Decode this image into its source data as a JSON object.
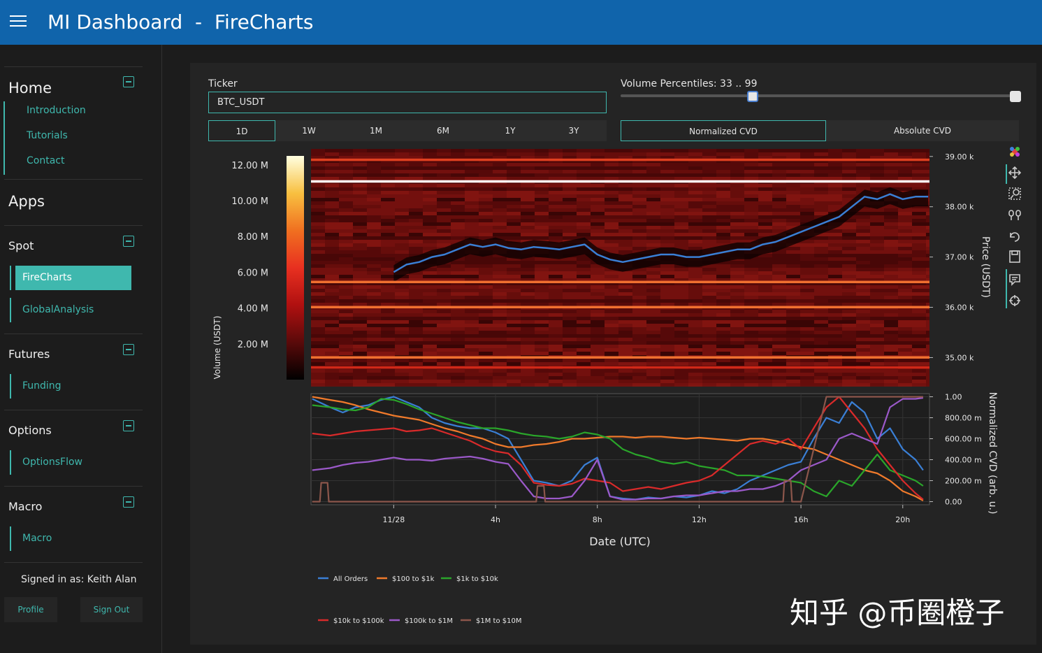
{
  "header": {
    "title": "MI Dashboard  -  FireCharts"
  },
  "sidebar": {
    "home": {
      "title": "Home",
      "items": [
        "Introduction",
        "Tutorials",
        "Contact"
      ]
    },
    "apps_title": "Apps",
    "spot": {
      "title": "Spot",
      "items": [
        "FireCharts",
        "GlobalAnalysis"
      ]
    },
    "futures": {
      "title": "Futures",
      "items": [
        "Funding"
      ]
    },
    "options": {
      "title": "Options",
      "items": [
        "OptionsFlow"
      ]
    },
    "macro": {
      "title": "Macro",
      "items": [
        "Macro"
      ]
    },
    "signed_in": "Signed in as: Keith Alan",
    "profile_label": "Profile",
    "signout_label": "Sign Out"
  },
  "controls": {
    "ticker_label": "Ticker",
    "ticker_value": "BTC_USDT",
    "ranges": [
      "1D",
      "1W",
      "1M",
      "6M",
      "1Y",
      "3Y"
    ],
    "active_range": "1D",
    "volume_percentiles_label": "Volume Percentiles: 33 .. 99",
    "volume_percentiles": [
      33,
      99
    ],
    "cvd_modes": [
      "Normalized CVD",
      "Absolute CVD"
    ],
    "active_cvd_mode": "Normalized CVD"
  },
  "toolbar": {
    "icons": [
      "plotly-logo-icon",
      "pan-icon",
      "zoom-icon",
      "compare-icon",
      "reset-icon",
      "save-icon",
      "hover-icon",
      "spike-icon"
    ]
  },
  "chart_data": [
    {
      "type": "heatmap",
      "colorbar_label": "Volume (USDT)",
      "colorbar_ticks": [
        "12.00 M",
        "10.00 M",
        "8.00 M",
        "6.00 M",
        "4.00 M",
        "2.00 M"
      ],
      "colorbar_tick_values": [
        12,
        10,
        8,
        6,
        4,
        2
      ],
      "colorbar_range": [
        0,
        12.5
      ],
      "colorscale": [
        "#000000",
        "#5a0a0a",
        "#b01010",
        "#e83020",
        "#f07020",
        "#f8c040",
        "#ffffe0"
      ],
      "ylabel": "Price (USDT)",
      "y_ticks": [
        "39.00 k",
        "38.00 k",
        "37.00 k",
        "36.00 k",
        "35.00 k"
      ],
      "y_tick_values": [
        39000,
        38000,
        37000,
        36000,
        35000
      ],
      "ylim": [
        34450,
        39150
      ],
      "bright_levels": [
        {
          "price": 38500,
          "color": "#ffffff"
        },
        {
          "price": 36500,
          "color": "#f07030"
        },
        {
          "price": 36000,
          "color": "#f07030"
        },
        {
          "price": 35000,
          "color": "#f07030"
        },
        {
          "price": 38930,
          "color": "#e04020"
        },
        {
          "price": 34800,
          "color": "#d02818"
        }
      ],
      "price_series": {
        "color": "#3a7fd5",
        "x": [
          0.0,
          0.5,
          1.0,
          1.5,
          2.0,
          2.5,
          3.0,
          3.5,
          4.0,
          4.5,
          5.0,
          5.5,
          6.0,
          6.5,
          7.0,
          7.5,
          8.0,
          8.5,
          9.0,
          9.5,
          10.0,
          10.5,
          11.0,
          11.5,
          12.0,
          12.5,
          13.0,
          13.5,
          14.0,
          14.5,
          15.0,
          15.5,
          16.0,
          16.5,
          17.0,
          17.5,
          18.0,
          18.5,
          19.0,
          19.5,
          20.0,
          20.5,
          21.0
        ],
        "y": [
          36700,
          36850,
          36900,
          37000,
          37050,
          37150,
          37250,
          37200,
          37250,
          37180,
          37150,
          37200,
          37180,
          37150,
          37200,
          37250,
          37050,
          36950,
          36900,
          36950,
          37000,
          37050,
          37050,
          37000,
          37000,
          37050,
          37100,
          37150,
          37150,
          37250,
          37300,
          37400,
          37500,
          37600,
          37700,
          37800,
          38000,
          38200,
          38150,
          38250,
          38150,
          38200,
          38200
        ]
      }
    },
    {
      "type": "line",
      "xlabel": "Date (UTC)",
      "x_ticks": [
        "11/28",
        "4h",
        "8h",
        "12h",
        "16h",
        "20h"
      ],
      "x_tick_values": [
        0.0,
        4.0,
        8.0,
        12.0,
        16.0,
        20.0
      ],
      "xlim": [
        -3.25,
        21.05
      ],
      "ylabel": "Normalized CVD (arb. u.)",
      "y_ticks": [
        "1.00",
        "800.00 m",
        "600.00 m",
        "400.00 m",
        "200.00 m",
        "0.00"
      ],
      "y_tick_values": [
        1.0,
        0.8,
        0.6,
        0.4,
        0.2,
        0.0
      ],
      "ylim": [
        -0.03,
        1.03
      ],
      "legend_position": "bottom",
      "series": [
        {
          "name": "All Orders",
          "color": "#3a7fd5",
          "x": [
            -3.2,
            -2.5,
            -2,
            -1.5,
            -1,
            -0.5,
            0,
            0.5,
            1,
            1.5,
            2,
            2.5,
            3,
            3.5,
            4,
            4.5,
            5,
            5.5,
            6,
            6.5,
            7,
            7.5,
            8,
            8.5,
            9,
            9.5,
            10,
            10.5,
            11,
            11.5,
            12,
            12.5,
            13,
            13.5,
            14,
            14.5,
            15,
            15.5,
            16,
            16.5,
            17,
            17.5,
            18,
            18.5,
            19,
            19.5,
            20,
            20.5,
            20.8
          ],
          "y": [
            0.98,
            0.9,
            0.85,
            0.9,
            0.92,
            0.97,
            1.0,
            0.95,
            0.9,
            0.8,
            0.75,
            0.72,
            0.7,
            0.7,
            0.66,
            0.6,
            0.4,
            0.2,
            0.18,
            0.15,
            0.2,
            0.35,
            0.42,
            0.05,
            0.03,
            0.02,
            0.04,
            0.03,
            0.05,
            0.04,
            0.06,
            0.1,
            0.08,
            0.12,
            0.2,
            0.25,
            0.3,
            0.35,
            0.38,
            0.6,
            0.8,
            0.75,
            0.95,
            0.85,
            0.6,
            0.7,
            0.5,
            0.4,
            0.3
          ]
        },
        {
          "name": "$100 to $1k",
          "color": "#f07a2b",
          "x": [
            -3.2,
            -2.5,
            -2,
            -1.5,
            -1,
            -0.5,
            0,
            0.5,
            1,
            1.5,
            2,
            2.5,
            3,
            3.5,
            4,
            4.5,
            5,
            5.5,
            6,
            6.5,
            7,
            7.5,
            8,
            8.5,
            9,
            9.5,
            10,
            10.5,
            11,
            11.5,
            12,
            12.5,
            13,
            13.5,
            14,
            14.5,
            15,
            15.5,
            16,
            16.5,
            17,
            17.5,
            18,
            18.5,
            19,
            19.5,
            20,
            20.5,
            20.8
          ],
          "y": [
            1.0,
            0.97,
            0.95,
            0.92,
            0.88,
            0.85,
            0.82,
            0.8,
            0.78,
            0.74,
            0.7,
            0.67,
            0.63,
            0.6,
            0.55,
            0.52,
            0.52,
            0.54,
            0.55,
            0.57,
            0.6,
            0.6,
            0.61,
            0.62,
            0.62,
            0.61,
            0.62,
            0.62,
            0.61,
            0.6,
            0.61,
            0.6,
            0.59,
            0.58,
            0.6,
            0.6,
            0.58,
            0.55,
            0.52,
            0.5,
            0.45,
            0.4,
            0.35,
            0.3,
            0.27,
            0.2,
            0.1,
            0.05,
            0.01
          ]
        },
        {
          "name": "$1k to $10k",
          "color": "#2aa52a",
          "x": [
            -3.2,
            -2.5,
            -2,
            -1.5,
            -1,
            -0.5,
            0,
            0.5,
            1,
            1.5,
            2,
            2.5,
            3,
            3.5,
            4,
            4.5,
            5,
            5.5,
            6,
            6.5,
            7,
            7.5,
            8,
            8.5,
            9,
            9.5,
            10,
            10.5,
            11,
            11.5,
            12,
            12.5,
            13,
            13.5,
            14,
            14.5,
            15,
            15.5,
            16,
            16.5,
            17,
            17.5,
            18,
            18.5,
            19,
            19.5,
            20,
            20.5,
            20.8
          ],
          "y": [
            0.92,
            0.9,
            0.88,
            0.87,
            0.9,
            0.98,
            0.97,
            0.93,
            0.88,
            0.84,
            0.8,
            0.76,
            0.73,
            0.7,
            0.7,
            0.68,
            0.65,
            0.63,
            0.62,
            0.6,
            0.62,
            0.66,
            0.64,
            0.6,
            0.5,
            0.45,
            0.42,
            0.38,
            0.36,
            0.38,
            0.34,
            0.32,
            0.3,
            0.25,
            0.25,
            0.24,
            0.22,
            0.2,
            0.18,
            0.1,
            0.05,
            0.2,
            0.15,
            0.3,
            0.45,
            0.3,
            0.25,
            0.2,
            0.15
          ]
        },
        {
          "name": "$10k to $100k",
          "color": "#d92a2a",
          "x": [
            -3.2,
            -2.5,
            -2,
            -1.5,
            -1,
            -0.5,
            0,
            0.5,
            1,
            1.5,
            2,
            2.5,
            3,
            3.5,
            4,
            4.5,
            5,
            5.5,
            6,
            6.5,
            7,
            7.5,
            8,
            8.5,
            9,
            9.5,
            10,
            10.5,
            11,
            11.5,
            12,
            12.5,
            13,
            13.5,
            14,
            14.5,
            15,
            15.5,
            16,
            16.5,
            17,
            17.5,
            18,
            18.5,
            19,
            19.5,
            20,
            20.5,
            20.8
          ],
          "y": [
            0.65,
            0.63,
            0.65,
            0.67,
            0.68,
            0.69,
            0.7,
            0.67,
            0.68,
            0.7,
            0.66,
            0.62,
            0.58,
            0.52,
            0.48,
            0.46,
            0.35,
            0.18,
            0.16,
            0.15,
            0.17,
            0.22,
            0.2,
            0.18,
            0.1,
            0.12,
            0.14,
            0.12,
            0.15,
            0.18,
            0.2,
            0.25,
            0.35,
            0.45,
            0.55,
            0.58,
            0.55,
            0.6,
            0.5,
            0.7,
            0.9,
            1.0,
            0.85,
            0.7,
            0.5,
            0.35,
            0.2,
            0.08,
            0.02
          ]
        },
        {
          "name": "$100k to $1M",
          "color": "#9b59c9",
          "x": [
            -3.2,
            -2.5,
            -2,
            -1.5,
            -1,
            -0.5,
            0,
            0.5,
            1,
            1.5,
            2,
            2.5,
            3,
            3.5,
            4,
            4.5,
            5,
            5.5,
            6,
            6.5,
            7,
            7.5,
            8,
            8.5,
            9,
            9.5,
            10,
            10.5,
            11,
            11.5,
            12,
            12.5,
            13,
            13.5,
            14,
            14.5,
            15,
            15.5,
            16,
            16.5,
            17,
            17.5,
            18,
            18.5,
            19,
            19.5,
            20,
            20.5,
            20.8
          ],
          "y": [
            0.3,
            0.32,
            0.35,
            0.37,
            0.38,
            0.4,
            0.42,
            0.4,
            0.4,
            0.39,
            0.41,
            0.42,
            0.43,
            0.41,
            0.38,
            0.36,
            0.2,
            0.05,
            0.03,
            0.03,
            0.05,
            0.2,
            0.4,
            0.05,
            0.02,
            0.02,
            0.03,
            0.03,
            0.05,
            0.06,
            0.06,
            0.08,
            0.1,
            0.1,
            0.12,
            0.12,
            0.15,
            0.2,
            0.3,
            0.35,
            0.4,
            0.6,
            0.65,
            0.6,
            0.55,
            0.9,
            0.98,
            0.98,
            0.99
          ]
        },
        {
          "name": "$1M to $10M",
          "color": "#8c564b",
          "x": [
            -3.2,
            -2.9,
            -2.85,
            -2.6,
            -2.55,
            -2.3,
            5.6,
            5.65,
            5.9,
            5.95,
            6.2,
            15.3,
            15.35,
            15.6,
            15.65,
            15.9,
            16.0,
            17.0,
            20.8
          ],
          "y": [
            0.0,
            0.0,
            0.18,
            0.18,
            0.0,
            0.0,
            0.0,
            0.15,
            0.15,
            0.0,
            0.0,
            0.0,
            0.2,
            0.2,
            0.0,
            0.0,
            0.0,
            1.0,
            1.0
          ]
        }
      ]
    }
  ],
  "watermark": "知乎 @币圈橙子"
}
